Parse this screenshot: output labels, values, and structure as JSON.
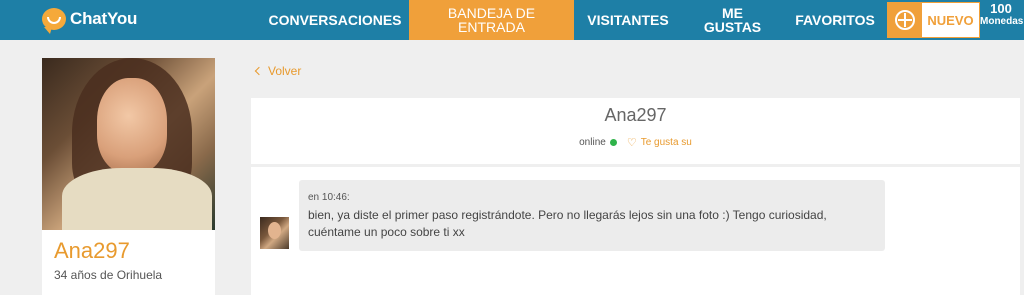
{
  "header": {
    "logo_text": "ChatYou",
    "nav": [
      {
        "label": "CONVERSACIONES"
      },
      {
        "label": "BANDEJA DE ENTRADA"
      },
      {
        "label": "VISITANTES"
      },
      {
        "label": "ME GUSTAS"
      },
      {
        "label": "FAVORITOS"
      }
    ],
    "coins_badge": "NUEVO",
    "coins_count": "100",
    "coins_unit": "Monedas"
  },
  "profile": {
    "name": "Ana297",
    "subtitle": "34 años de Orihuela"
  },
  "back_label": "Volver",
  "conversation": {
    "title": "Ana297",
    "status": "online",
    "likes_label": "Te gusta su"
  },
  "messages": [
    {
      "time": "en 10:46:",
      "text": "bien, ya diste el primer paso registrándote. Pero no llegarás lejos sin una foto :) Tengo curiosidad, cuéntame un poco sobre ti xx"
    }
  ],
  "colors": {
    "nav_bg": "#1e7fa6",
    "accent": "#f0a03a",
    "online": "#2fb34a"
  }
}
